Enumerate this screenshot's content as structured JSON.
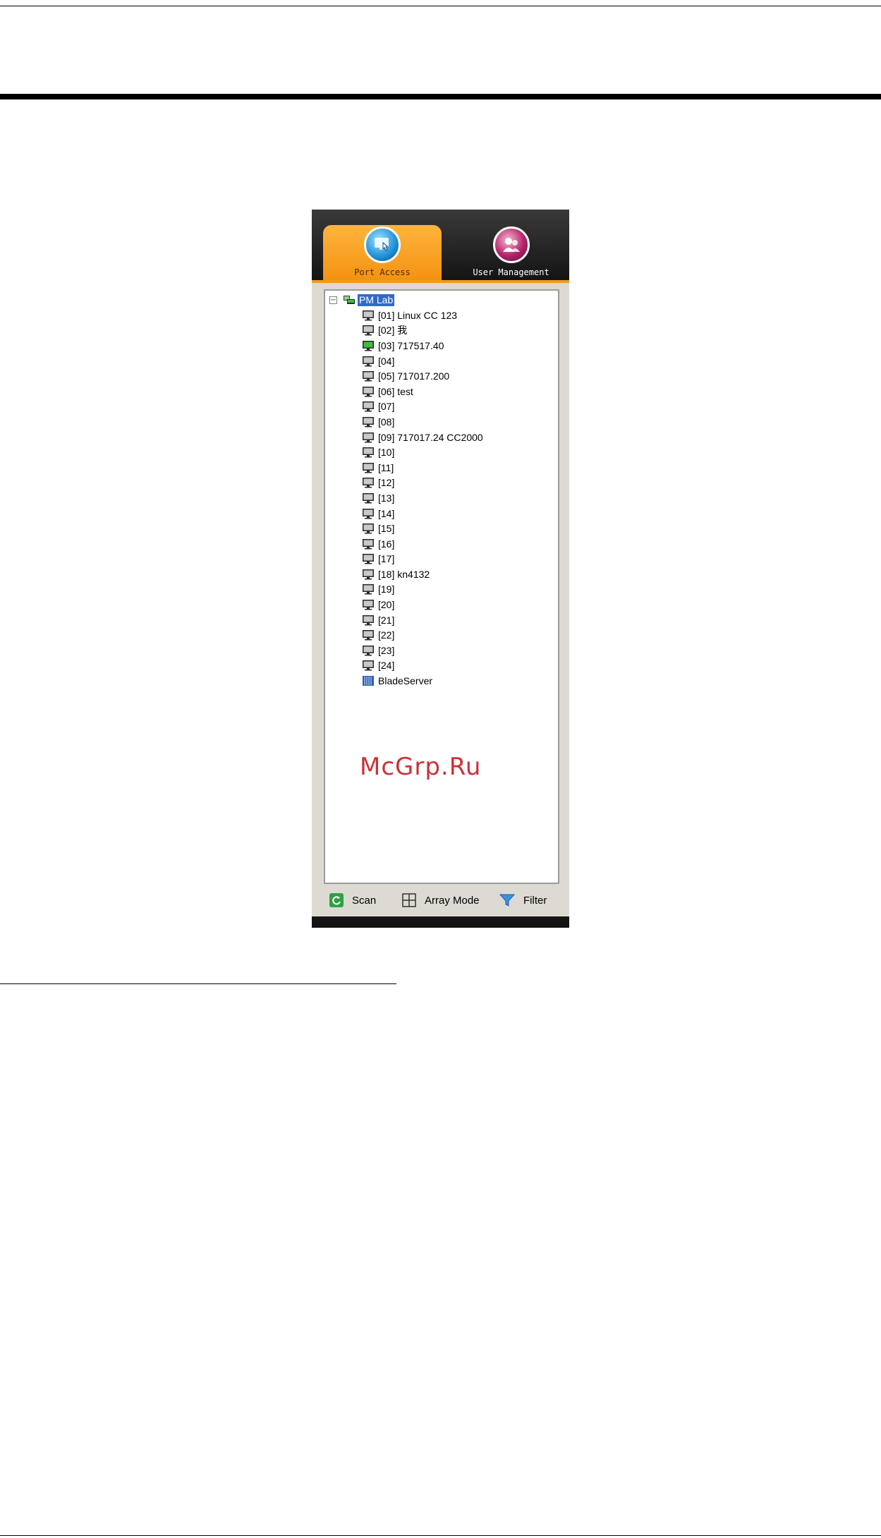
{
  "tabs": {
    "port_access": "Port Access",
    "user_management": "User Management"
  },
  "tree": {
    "root": "PM Lab",
    "expander": "−",
    "ports": [
      {
        "label": "[01] Linux CC 123",
        "status": "offline"
      },
      {
        "label": "[02] 我",
        "status": "offline"
      },
      {
        "label": "[03] 717517.40",
        "status": "online"
      },
      {
        "label": "[04]",
        "status": "offline"
      },
      {
        "label": "[05] 717017.200",
        "status": "offline"
      },
      {
        "label": "[06] test",
        "status": "offline"
      },
      {
        "label": "[07]",
        "status": "offline"
      },
      {
        "label": "[08]",
        "status": "offline"
      },
      {
        "label": "[09] 717017.24 CC2000",
        "status": "offline"
      },
      {
        "label": "[10]",
        "status": "offline"
      },
      {
        "label": "[11]",
        "status": "offline"
      },
      {
        "label": "[12]",
        "status": "offline"
      },
      {
        "label": "[13]",
        "status": "offline"
      },
      {
        "label": "[14]",
        "status": "offline"
      },
      {
        "label": "[15]",
        "status": "offline"
      },
      {
        "label": "[16]",
        "status": "offline"
      },
      {
        "label": "[17]",
        "status": "offline"
      },
      {
        "label": "[18] kn4132",
        "status": "offline"
      },
      {
        "label": "[19]",
        "status": "offline"
      },
      {
        "label": "[20]",
        "status": "offline"
      },
      {
        "label": "[21]",
        "status": "offline"
      },
      {
        "label": "[22]",
        "status": "offline"
      },
      {
        "label": "[23]",
        "status": "offline"
      },
      {
        "label": "[24]",
        "status": "offline"
      },
      {
        "label": "BladeServer",
        "status": "blade"
      }
    ]
  },
  "footer": {
    "scan": "Scan",
    "array_mode": "Array Mode",
    "filter": "Filter"
  },
  "watermark": "McGrp.Ru",
  "colors": {
    "tab_active": "#f39212",
    "selection": "#316ac5",
    "online": "#3cbf3c",
    "watermark": "#c9323a"
  }
}
